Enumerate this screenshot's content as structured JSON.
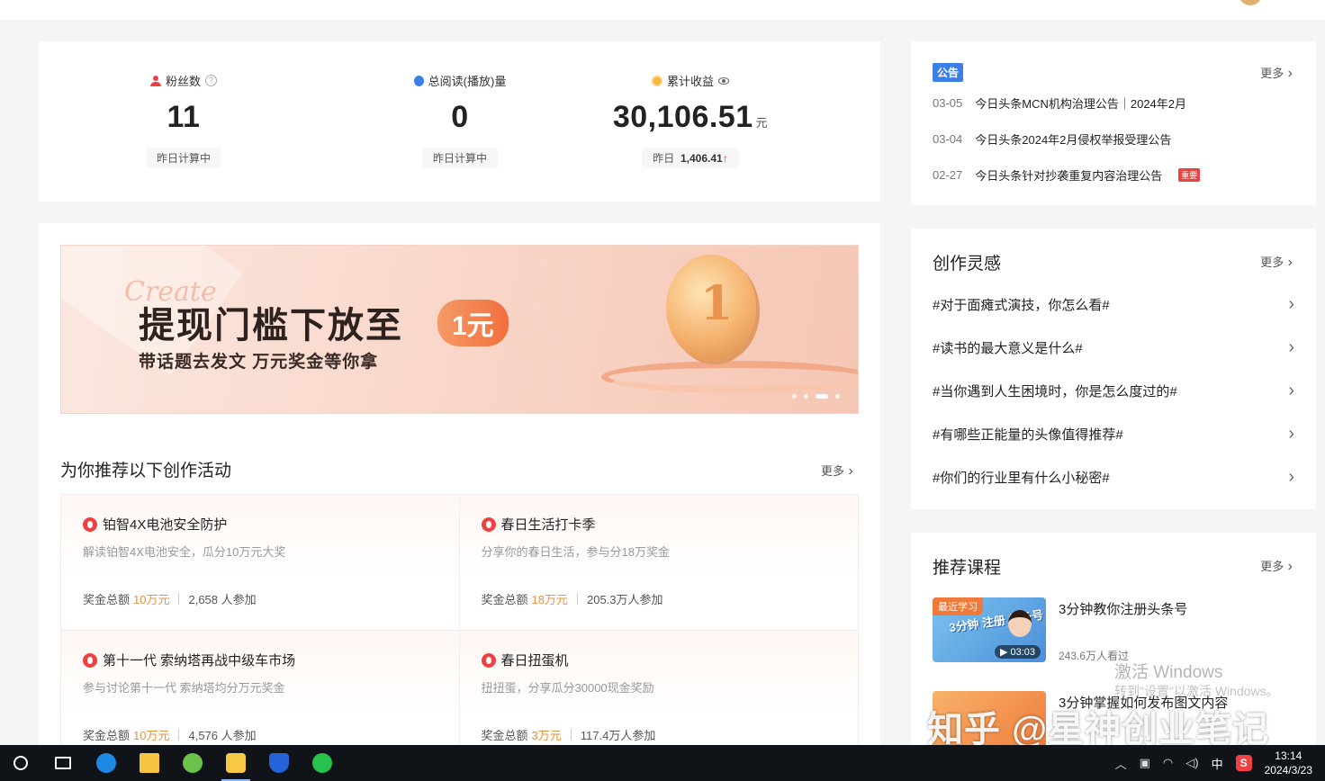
{
  "stats": {
    "fans": {
      "label": "粉丝数",
      "value": "11",
      "foot": "昨日计算中"
    },
    "reads": {
      "label": "总阅读(播放)量",
      "value": "0",
      "foot": "昨日计算中"
    },
    "earnings": {
      "label": "累计收益",
      "value": "30,106.51",
      "unit": "元",
      "foot_label": "昨日",
      "foot_value": "1,406.41",
      "trend": "↑"
    }
  },
  "banner": {
    "script_text": "Create",
    "headline": "提现门槛下放至",
    "pill": "1元",
    "subline": "带话题去发文 万元奖金等你拿",
    "coin_number": "1"
  },
  "activities": {
    "title": "为你推荐以下创作活动",
    "more": "更多",
    "items": [
      {
        "title": "铂智4X电池安全防护",
        "desc": "解读铂智4X电池安全，瓜分10万元大奖",
        "prize_label": "奖金总额",
        "prize": "10万元",
        "participants": "2,658 人参加"
      },
      {
        "title": "春日生活打卡季",
        "desc": "分享你的春日生活，参与分18万奖金",
        "prize_label": "奖金总额",
        "prize": "18万元",
        "participants": "205.3万人参加"
      },
      {
        "title": "第十一代 索纳塔再战中级车市场",
        "desc": "参与讨论第十一代 索纳塔均分万元奖金",
        "prize_label": "奖金总额",
        "prize": "10万元",
        "participants": "4,576 人参加"
      },
      {
        "title": "春日扭蛋机",
        "desc": "扭扭蛋，分享瓜分30000现金奖励",
        "prize_label": "奖金总额",
        "prize": "3万元",
        "participants": "117.4万人参加"
      }
    ]
  },
  "notice": {
    "tag": "公告",
    "more": "更多",
    "items": [
      {
        "date": "03-05",
        "text": "今日头条MCN机构治理公告｜2024年2月",
        "badge": ""
      },
      {
        "date": "03-04",
        "text": "今日头条2024年2月侵权举报受理公告",
        "badge": ""
      },
      {
        "date": "02-27",
        "text": "今日头条针对抄袭重复内容治理公告",
        "badge": "重要"
      }
    ]
  },
  "inspiration": {
    "title": "创作灵感",
    "more": "更多",
    "topics": [
      "#对于面瘫式演技，你怎么看#",
      "#读书的最大意义是什么#",
      "#当你遇到人生困境时，你是怎么度过的#",
      "#有哪些正能量的头像值得推荐#",
      "#你们的行业里有什么小秘密#"
    ]
  },
  "courses": {
    "title": "推荐课程",
    "more": "更多",
    "items": [
      {
        "title": "3分钟教你注册头条号",
        "views": "243.6万人看过",
        "thumb_tag": "最近学习",
        "thumb_text": "3分钟 注册 头条号",
        "duration": "▶ 03:03"
      },
      {
        "title": "3分钟掌握如何发布图文内容",
        "views": "",
        "thumb_tag": "",
        "thumb_text": "",
        "duration": ""
      }
    ]
  },
  "watermarks": {
    "windows": "激活 Windows",
    "windows_sub": "转到\"设置\"以激活 Windows。",
    "zhihu": "知乎 @星神创业笔记"
  },
  "taskbar": {
    "apps": [
      "task-view-icon",
      "edge-icon",
      "file-explorer-icon",
      "green-browser-icon",
      "m-app-icon",
      "shield-app-icon",
      "wechat-icon"
    ],
    "ime": "中",
    "sogou": "S",
    "time": "13:14",
    "date": "2024/3/23"
  },
  "colors": {
    "accent_red": "#f04142",
    "accent_blue": "#3c7ee8",
    "prize_orange": "#e8913a"
  }
}
